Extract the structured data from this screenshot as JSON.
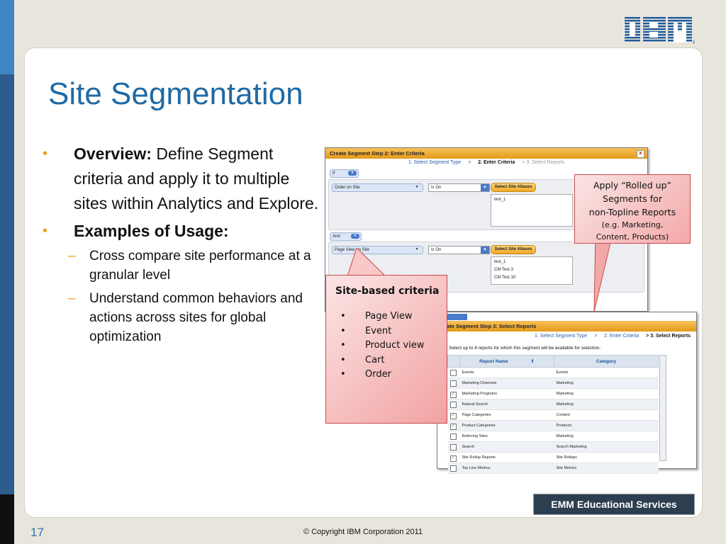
{
  "brand": {
    "logo": "IBM",
    "registered": "®"
  },
  "slide": {
    "title": "Site Segmentation",
    "bullets": [
      {
        "bold": "Overview:",
        "text": " Define Segment criteria and apply it to multiple sites within Analytics and Explore."
      },
      {
        "bold": "Examples of Usage:",
        "text": ""
      }
    ],
    "subbullets": [
      "Cross compare site performance at a granular level",
      "Understand common behaviors and actions across sites for global optimization"
    ],
    "page_number": "17",
    "copyright": "© Copyright IBM Corporation 2011",
    "footer_badge": "EMM Educational Services"
  },
  "screen1": {
    "title": "Create Segment Step 2: Enter Criteria",
    "close": "x",
    "steps": [
      "1.  Select Segment Type",
      ">",
      "2.  Enter Criteria",
      "> 3.  Select Reports"
    ],
    "if_label": "If",
    "and_label": "And",
    "row1": {
      "criteria": "Order on Site",
      "operator": "Is On",
      "button": "Select Site Aliases",
      "values": [
        "test_1"
      ]
    },
    "row2": {
      "criteria": "Page View on Site",
      "operator": "Is On",
      "button": "Select Site Aliases",
      "values": [
        "test_1",
        "CM Test 3",
        "CM Test 10"
      ]
    }
  },
  "screen2": {
    "title": "reate Segment Step 3: Select Reports",
    "corner": "ll",
    "steps": [
      "1.  Select Segment Type",
      ">",
      "2.  Enter Criteria",
      "> 3.  Select Reports"
    ],
    "intro": "Select up to 4 reports for which this segment will be available for selection.",
    "columns": [
      "Report Name",
      "Category"
    ],
    "rows": [
      {
        "name": "Events",
        "category": "Events",
        "checked": false
      },
      {
        "name": "Marketing Channels",
        "category": "Marketing",
        "checked": false
      },
      {
        "name": "Marketing Programs",
        "category": "Marketing",
        "checked": true
      },
      {
        "name": "Natural Search",
        "category": "Marketing",
        "checked": false
      },
      {
        "name": "Page Categories",
        "category": "Content",
        "checked": true
      },
      {
        "name": "Product Categories",
        "category": "Products",
        "checked": true
      },
      {
        "name": "Referring Sites",
        "category": "Marketing",
        "checked": false
      },
      {
        "name": "Search",
        "category": "Search Marketing",
        "checked": false
      },
      {
        "name": "Site Rollup Reports",
        "category": "Site Rollups",
        "checked": true
      },
      {
        "name": "Top Line Metrics",
        "category": "Site Metrics",
        "checked": false
      }
    ]
  },
  "callout_criteria": {
    "title": "Site-based criteria",
    "bullet": "•",
    "items": [
      "Page View",
      "Event",
      "Product view",
      "Cart",
      "Order"
    ]
  },
  "callout_rollup": {
    "lines": [
      "Apply “Rolled up”",
      "Segments for",
      "non-Topline Reports"
    ],
    "small": [
      "(e.g. Marketing,",
      "Content, Products)"
    ]
  },
  "colors": {
    "title": "#1f6aa5",
    "bullet": "#f0a020",
    "callout": "#f2a2a2",
    "header": "#e49a1a",
    "badge": "#2d3e50"
  }
}
